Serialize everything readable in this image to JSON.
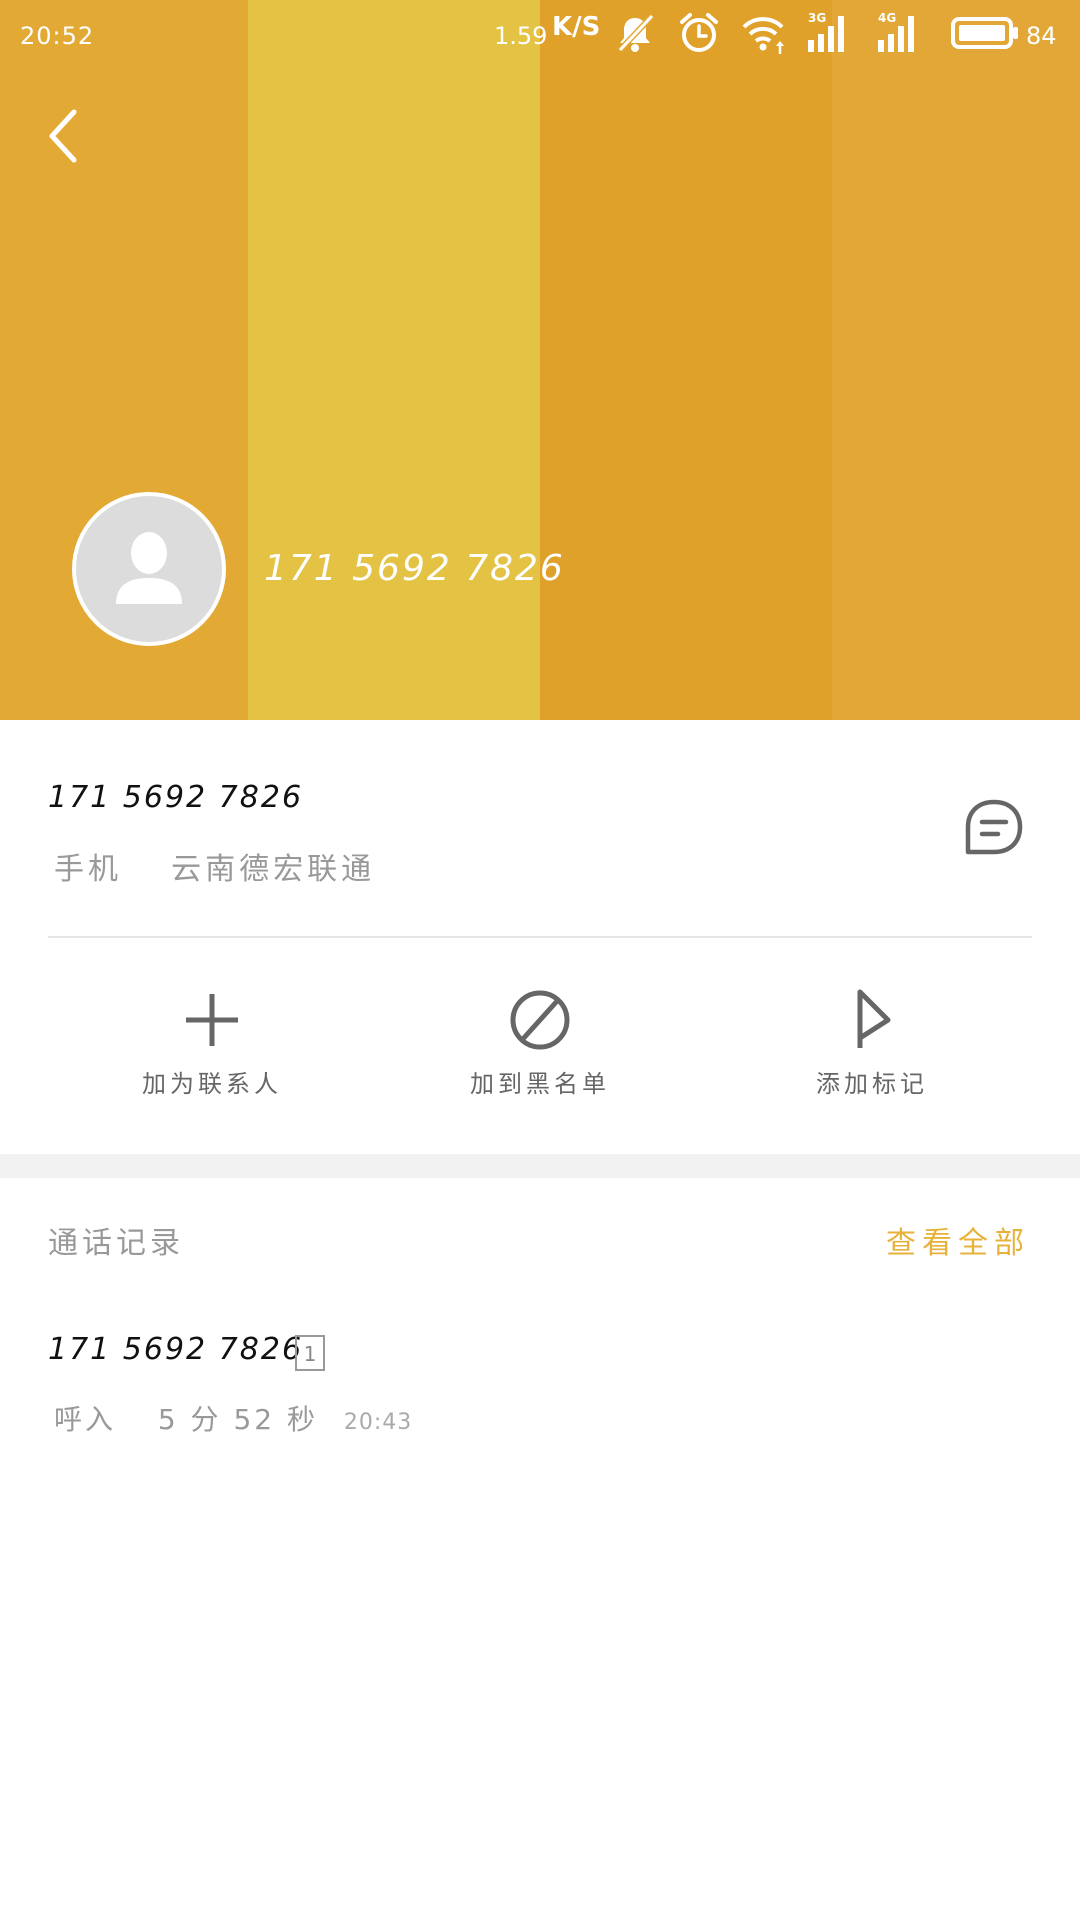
{
  "status_bar": {
    "time": "20:52",
    "net_speed": "1.59",
    "net_unit": "K/S",
    "icons": [
      "mute-icon",
      "alarm-icon",
      "wifi-icon",
      "signal-3g-icon",
      "signal-4g-icon",
      "battery-icon"
    ],
    "signal_3g_label": "3G",
    "signal_4g_label": "4G",
    "battery": "84"
  },
  "header": {
    "phone_number": "171 5692 7826",
    "stripe_colors": [
      "#e3a935",
      "#e3c244",
      "#e0a12b",
      "#e3a737"
    ]
  },
  "info": {
    "phone_number": "171 5692 7826",
    "type": "手机",
    "location": "云南德宏联通"
  },
  "actions": [
    {
      "label": "加为联系人",
      "icon": "plus-icon"
    },
    {
      "label": "加到黑名单",
      "icon": "block-icon"
    },
    {
      "label": "添加标记",
      "icon": "flag-icon"
    }
  ],
  "call_log": {
    "title": "通话记录",
    "view_all": "查看全部",
    "accent_color": "#e6b23a",
    "entries": [
      {
        "number": "171 5692 7826",
        "sim": "1",
        "direction": "呼入",
        "duration": "5 分 52 秒",
        "time": "20:43"
      }
    ]
  }
}
